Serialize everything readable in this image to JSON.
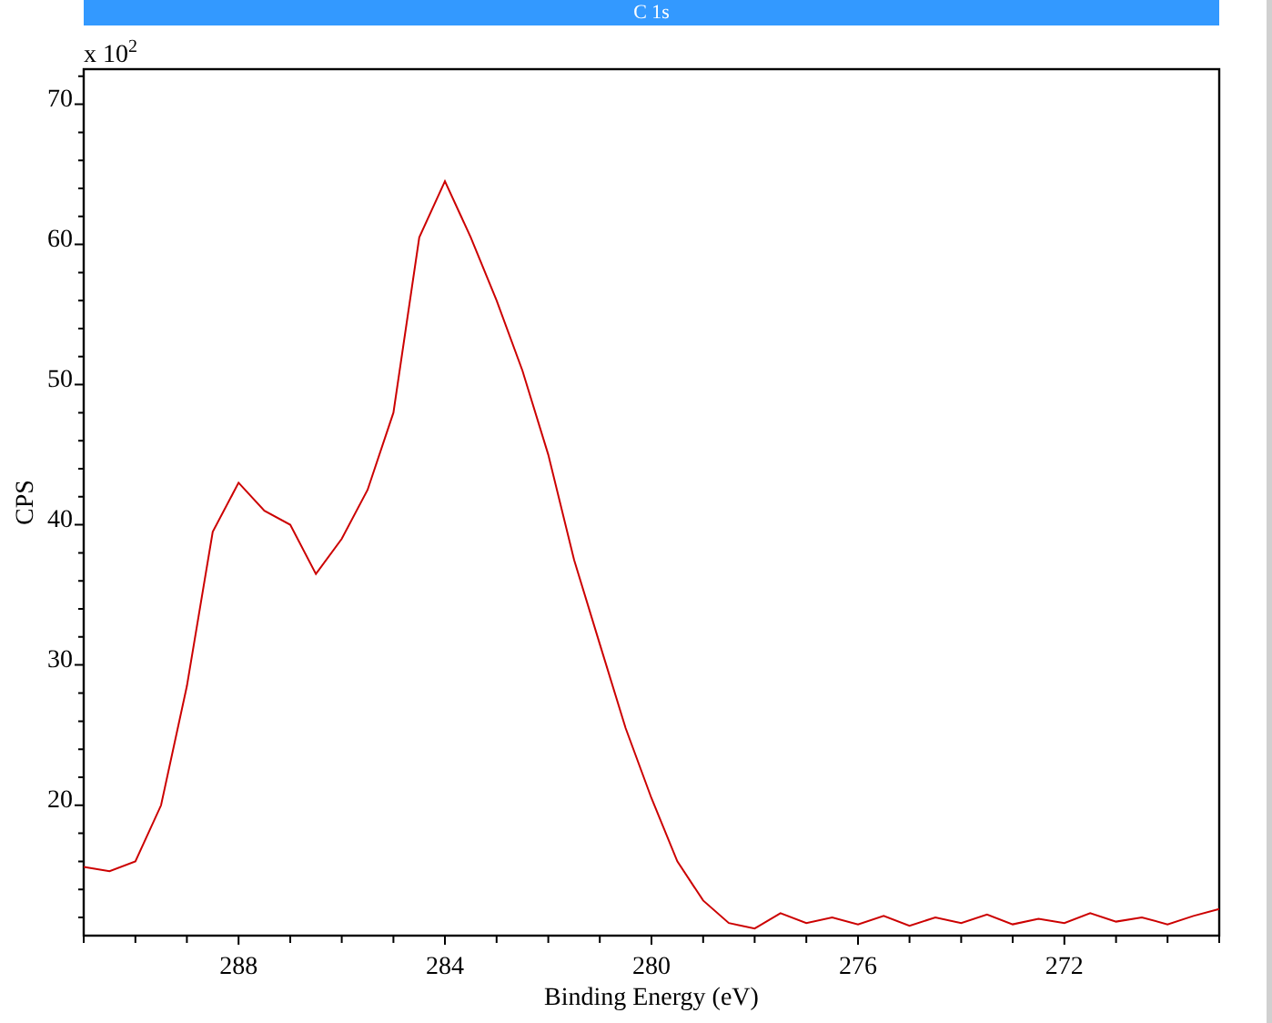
{
  "plot": {
    "y_multiplier": "x 10$^{2}$",
    "chart_data": {
      "type": "line",
      "title": "C 1s",
      "xlabel": "Binding Energy (eV)",
      "ylabel": "CPS",
      "xlim": [
        291,
        269
      ],
      "ylim": [
        10.7,
        72.5
      ],
      "xticks": [
        288,
        284,
        280,
        276,
        272
      ],
      "yticks": [
        20,
        30,
        40,
        50,
        60,
        70
      ],
      "x": [
        291,
        290.5,
        290,
        289.5,
        289,
        288.5,
        288,
        287.5,
        287,
        286.5,
        286,
        285.5,
        285,
        284.5,
        284,
        283.5,
        283,
        282.5,
        282,
        281.5,
        281,
        280.5,
        280,
        279.5,
        279,
        278.5,
        278,
        277.5,
        277,
        276.5,
        276,
        275.5,
        275,
        274.5,
        274,
        273.5,
        273,
        272.5,
        272,
        271.5,
        271,
        270.5,
        270,
        269.5,
        269
      ],
      "series": [
        {
          "color": "#cc0000",
          "values": [
            15.6,
            15.3,
            16.0,
            20.0,
            28.5,
            39.5,
            43.0,
            41.0,
            40.0,
            36.5,
            39.0,
            42.5,
            48.0,
            60.5,
            64.5,
            60.5,
            56.0,
            51.0,
            45.0,
            37.5,
            31.5,
            25.5,
            20.5,
            16.0,
            13.2,
            11.6,
            11.2,
            12.3,
            11.6,
            12.0,
            11.5,
            12.1,
            11.4,
            12.0,
            11.6,
            12.2,
            11.5,
            11.9,
            11.6,
            12.3,
            11.7,
            12.0,
            11.5,
            12.1,
            12.6
          ]
        }
      ]
    }
  }
}
